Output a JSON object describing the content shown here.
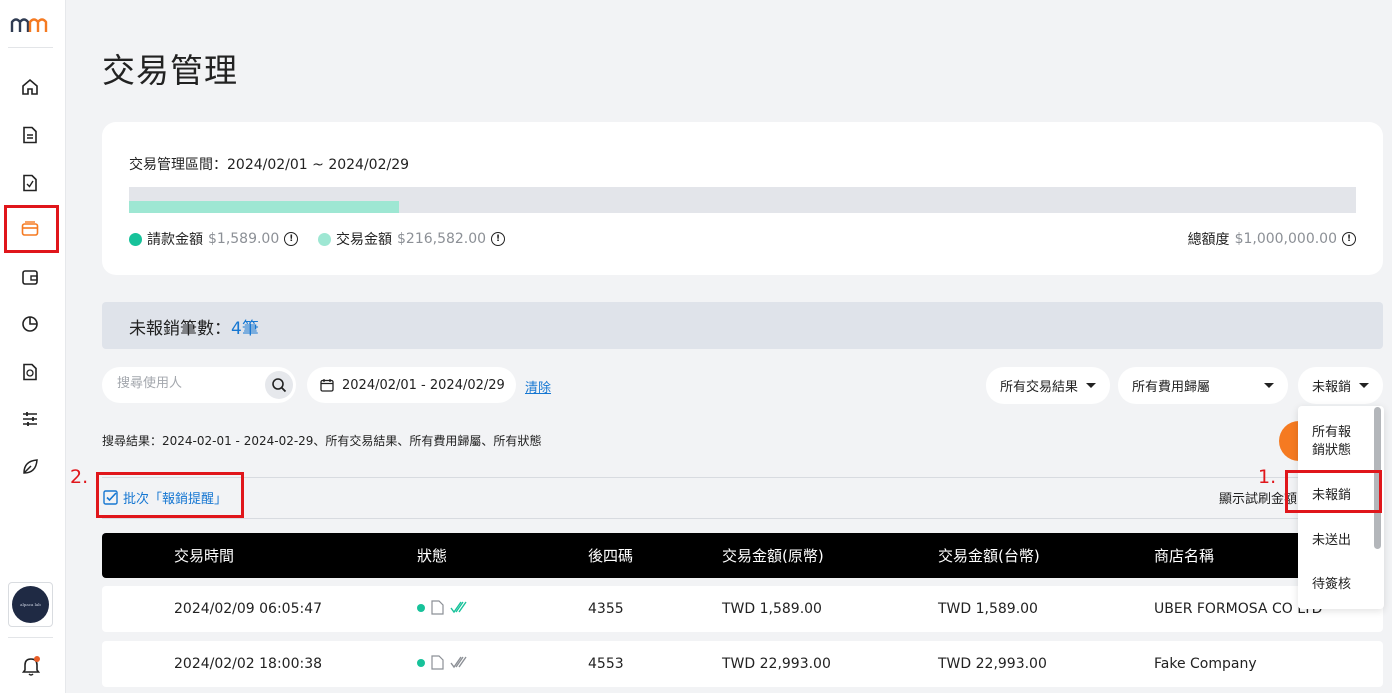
{
  "sidebar": {
    "logo": "MM",
    "items": [
      {
        "name": "home-icon"
      },
      {
        "name": "document-icon"
      },
      {
        "name": "document-export-icon"
      },
      {
        "name": "credit-card-icon"
      },
      {
        "name": "wallet-icon"
      },
      {
        "name": "pie-chart-icon"
      },
      {
        "name": "money-document-icon"
      },
      {
        "name": "sliders-icon"
      },
      {
        "name": "leaf-icon"
      }
    ],
    "avatar_text": "alpaca lab",
    "accent": "#f57a21"
  },
  "page": {
    "title": "交易管理"
  },
  "summary": {
    "period": "交易管理區間：2024/02/01 ~ 2024/02/29",
    "bar_fill_fraction": 0.22,
    "bar_color": "#9ee7d3",
    "claim_label": "請款金額",
    "claim_value": "$1,589.00",
    "claim_color": "#17c29a",
    "txn_label": "交易金額",
    "txn_value": "$216,582.00",
    "txn_color": "#9ee7d3",
    "total_label": "總額度",
    "total_value": "$1,000,000.00"
  },
  "banner": {
    "label": "未報銷筆數：",
    "count": "4筆"
  },
  "filters": {
    "search_placeholder": "搜尋使用人",
    "date_range": "2024/02/01 - 2024/02/29",
    "clear": "清除",
    "result_filter": "所有交易結果",
    "expense_filter": "所有費用歸屬",
    "status_filter": "未報銷"
  },
  "results_text": "搜尋結果：2024-02-01 - 2024-02-29、所有交易結果、所有費用歸屬、所有狀態",
  "batch_label": "批次「報銷提醒」",
  "display_label": "顯示試刷金額",
  "annotations": {
    "step1": "1.",
    "step2": "2."
  },
  "table": {
    "headers": [
      "交易時間",
      "狀態",
      "後四碼",
      "交易金額(原幣)",
      "交易金額(台幣)",
      "商店名稱"
    ],
    "rows": [
      {
        "time": "2024/02/09 06:05:47",
        "last4": "4355",
        "orig": "TWD 1,589.00",
        "twd": "TWD 1,589.00",
        "store": "UBER FORMOSA CO LTD"
      },
      {
        "time": "2024/02/02 18:00:38",
        "last4": "4553",
        "orig": "TWD 22,993.00",
        "twd": "TWD 22,993.00",
        "store": "Fake Company"
      }
    ]
  },
  "status_menu": {
    "items": [
      "所有報",
      "銷狀態",
      "未報銷",
      "未送出",
      "待簽核"
    ]
  }
}
